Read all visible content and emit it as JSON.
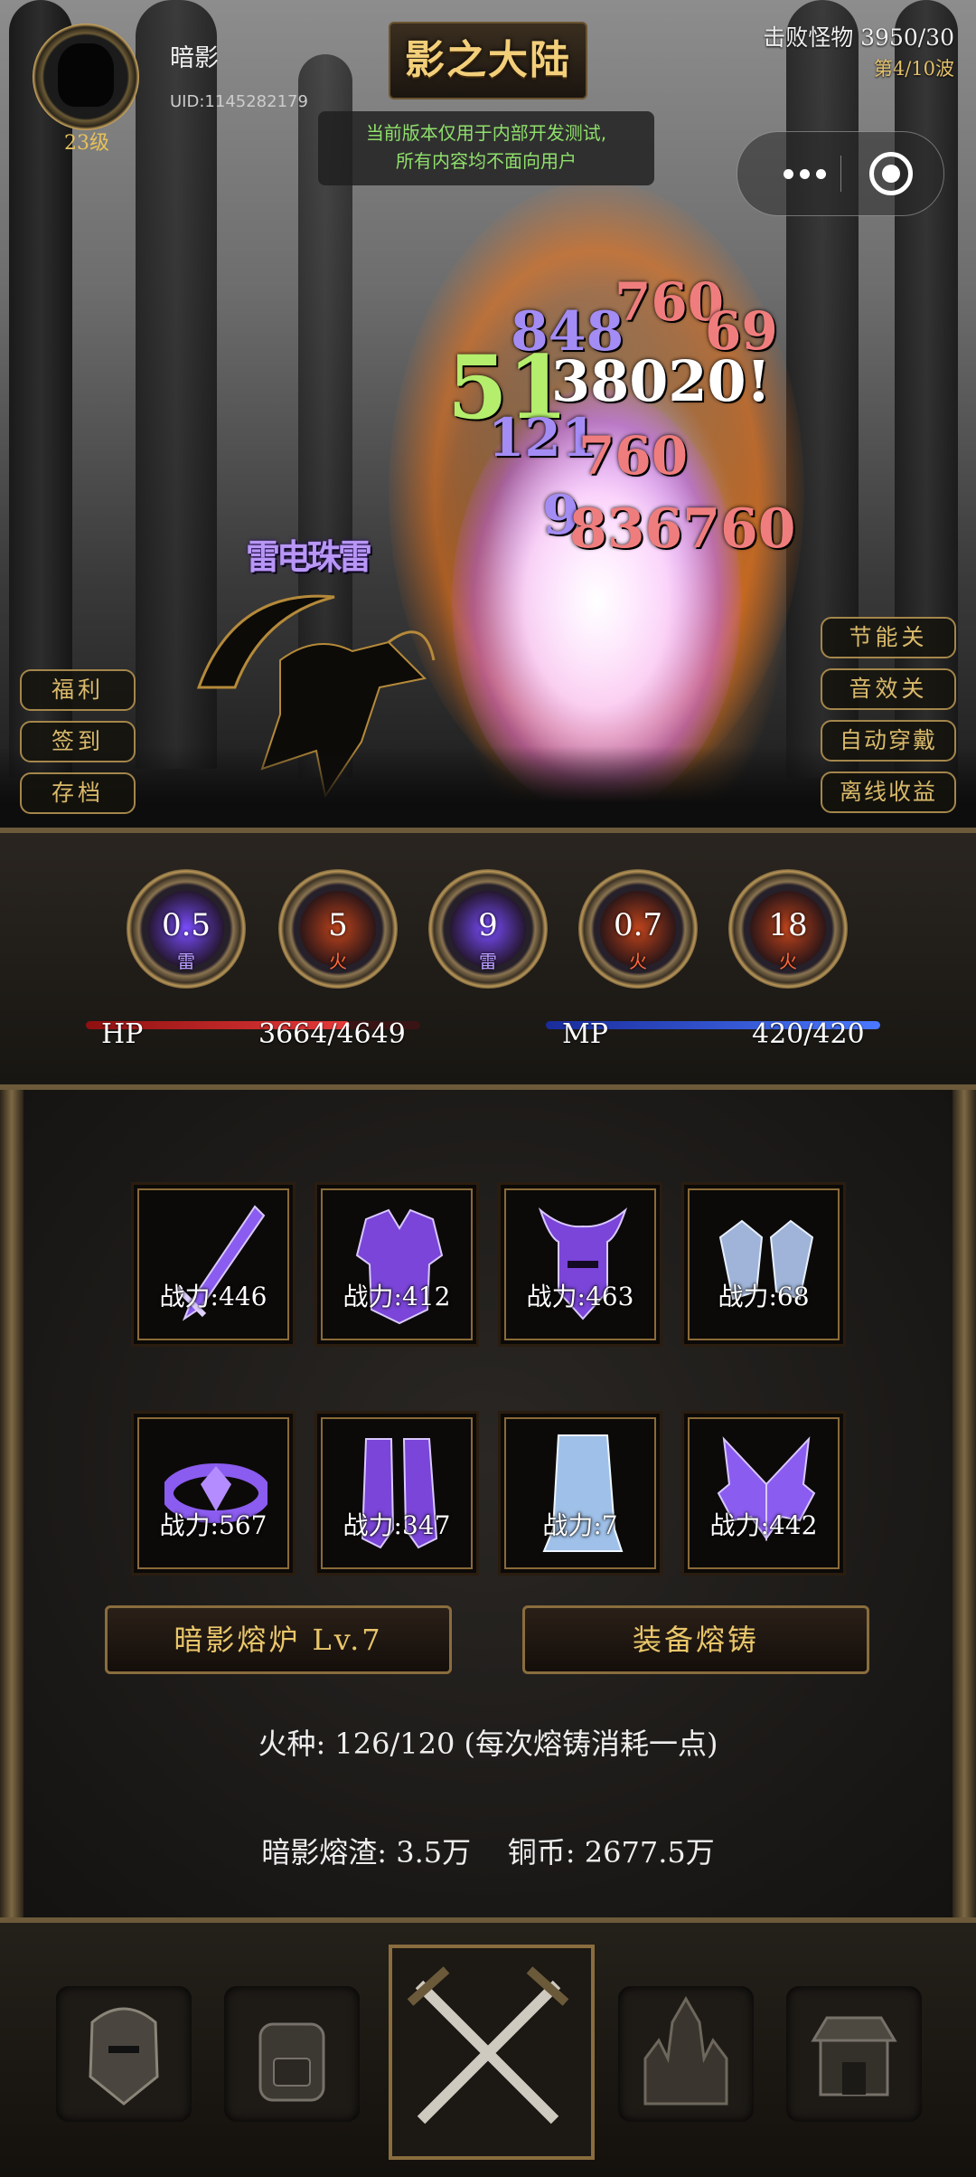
{
  "player": {
    "name": "暗影",
    "uid": "UID:1145282179",
    "level": "23级"
  },
  "game_title": "影之大陆",
  "progress": {
    "kills": "击败怪物 3950/30",
    "wave": "第4/10波"
  },
  "notice": {
    "line1": "当前版本仅用于内部开发测试,",
    "line2": "所有内容均不面向用户"
  },
  "enemy": {
    "name": "雷电珠雷"
  },
  "damage_numbers": [
    "760",
    "848",
    "69",
    "51",
    "38020!",
    "121",
    "760",
    "9",
    "836760"
  ],
  "left_menu": [
    {
      "label": "福利"
    },
    {
      "label": "签到"
    },
    {
      "label": "存档"
    }
  ],
  "right_menu": [
    {
      "label": "节能关"
    },
    {
      "label": "音效关"
    },
    {
      "label": "自动穿戴"
    },
    {
      "label": "离线收益"
    }
  ],
  "skills": [
    {
      "value": "0.5",
      "element": "雷",
      "color": "#7a4dff"
    },
    {
      "value": "5",
      "element": "火",
      "color": "#c0441c"
    },
    {
      "value": "9",
      "element": "雷",
      "color": "#7a4dff"
    },
    {
      "value": "0.7",
      "element": "火",
      "color": "#c0441c"
    },
    {
      "value": "18",
      "element": "火",
      "color": "#c0441c"
    }
  ],
  "stats": {
    "hp_label": "HP",
    "hp_value": "3664/4649",
    "hp_fraction": 0.788,
    "mp_label": "MP",
    "mp_value": "420/420",
    "mp_fraction": 1.0
  },
  "equipment": [
    {
      "power": "战力:446",
      "icon": "sword-icon"
    },
    {
      "power": "战力:412",
      "icon": "armor-icon"
    },
    {
      "power": "战力:463",
      "icon": "helmet-icon"
    },
    {
      "power": "战力:68",
      "icon": "gauntlet-icon"
    },
    {
      "power": "战力:567",
      "icon": "belt-icon"
    },
    {
      "power": "战力:347",
      "icon": "boots-icon"
    },
    {
      "power": "战力:7",
      "icon": "ice-boots-icon"
    },
    {
      "power": "战力:442",
      "icon": "wings-icon"
    }
  ],
  "furnace_button": "暗影熔炉 Lv.7",
  "forge_button": "装备熔铸",
  "sparks_text": "火种: 126/120 (每次熔铸消耗一点)",
  "resources_text": "暗影熔渣: 3.5万    铜币: 2677.5万",
  "nav": [
    {
      "icon": "helmet-icon"
    },
    {
      "icon": "backpack-icon"
    },
    {
      "icon": "crossed-swords-icon"
    },
    {
      "icon": "castle-icon"
    },
    {
      "icon": "shop-icon"
    }
  ],
  "colors": {
    "gold": "#e9c66a",
    "notice_green": "#8fe06b",
    "hp_red": "#d2282a",
    "mp_blue": "#2e54e0"
  }
}
